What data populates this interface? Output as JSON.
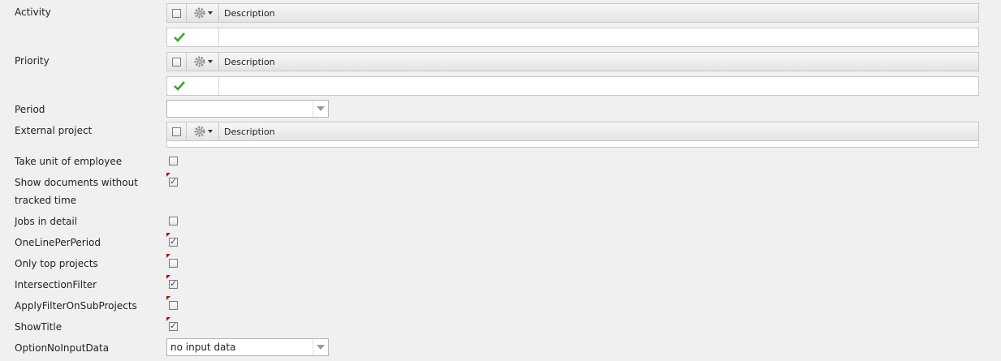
{
  "fields": {
    "activity": {
      "label": "Activity",
      "grid_desc_header": "Description"
    },
    "priority": {
      "label": "Priority",
      "grid_desc_header": "Description"
    },
    "period": {
      "label": "Period",
      "value": ""
    },
    "external_project": {
      "label": "External project",
      "grid_desc_header": "Description"
    },
    "take_unit": {
      "label": "Take unit of employee",
      "checked": false
    },
    "show_documents": {
      "label": "Show documents without tracked time",
      "checked": true
    },
    "jobs_in_detail": {
      "label": "Jobs in detail",
      "checked": false
    },
    "one_line_per_period": {
      "label": "OneLinePerPeriod",
      "checked": true
    },
    "only_top_projects": {
      "label": "Only top projects",
      "checked": false
    },
    "intersection_filter": {
      "label": "IntersectionFilter",
      "checked": true
    },
    "apply_filter_sub": {
      "label": "ApplyFilterOnSubProjects",
      "checked": false
    },
    "show_title": {
      "label": "ShowTitle",
      "checked": true
    },
    "option_no_input": {
      "label": "OptionNoInputData",
      "value": "no input data"
    }
  },
  "colors": {
    "accent": "#2a3f8f",
    "dirty_marker": "#b01010",
    "checkmark": "#3aa02a"
  }
}
